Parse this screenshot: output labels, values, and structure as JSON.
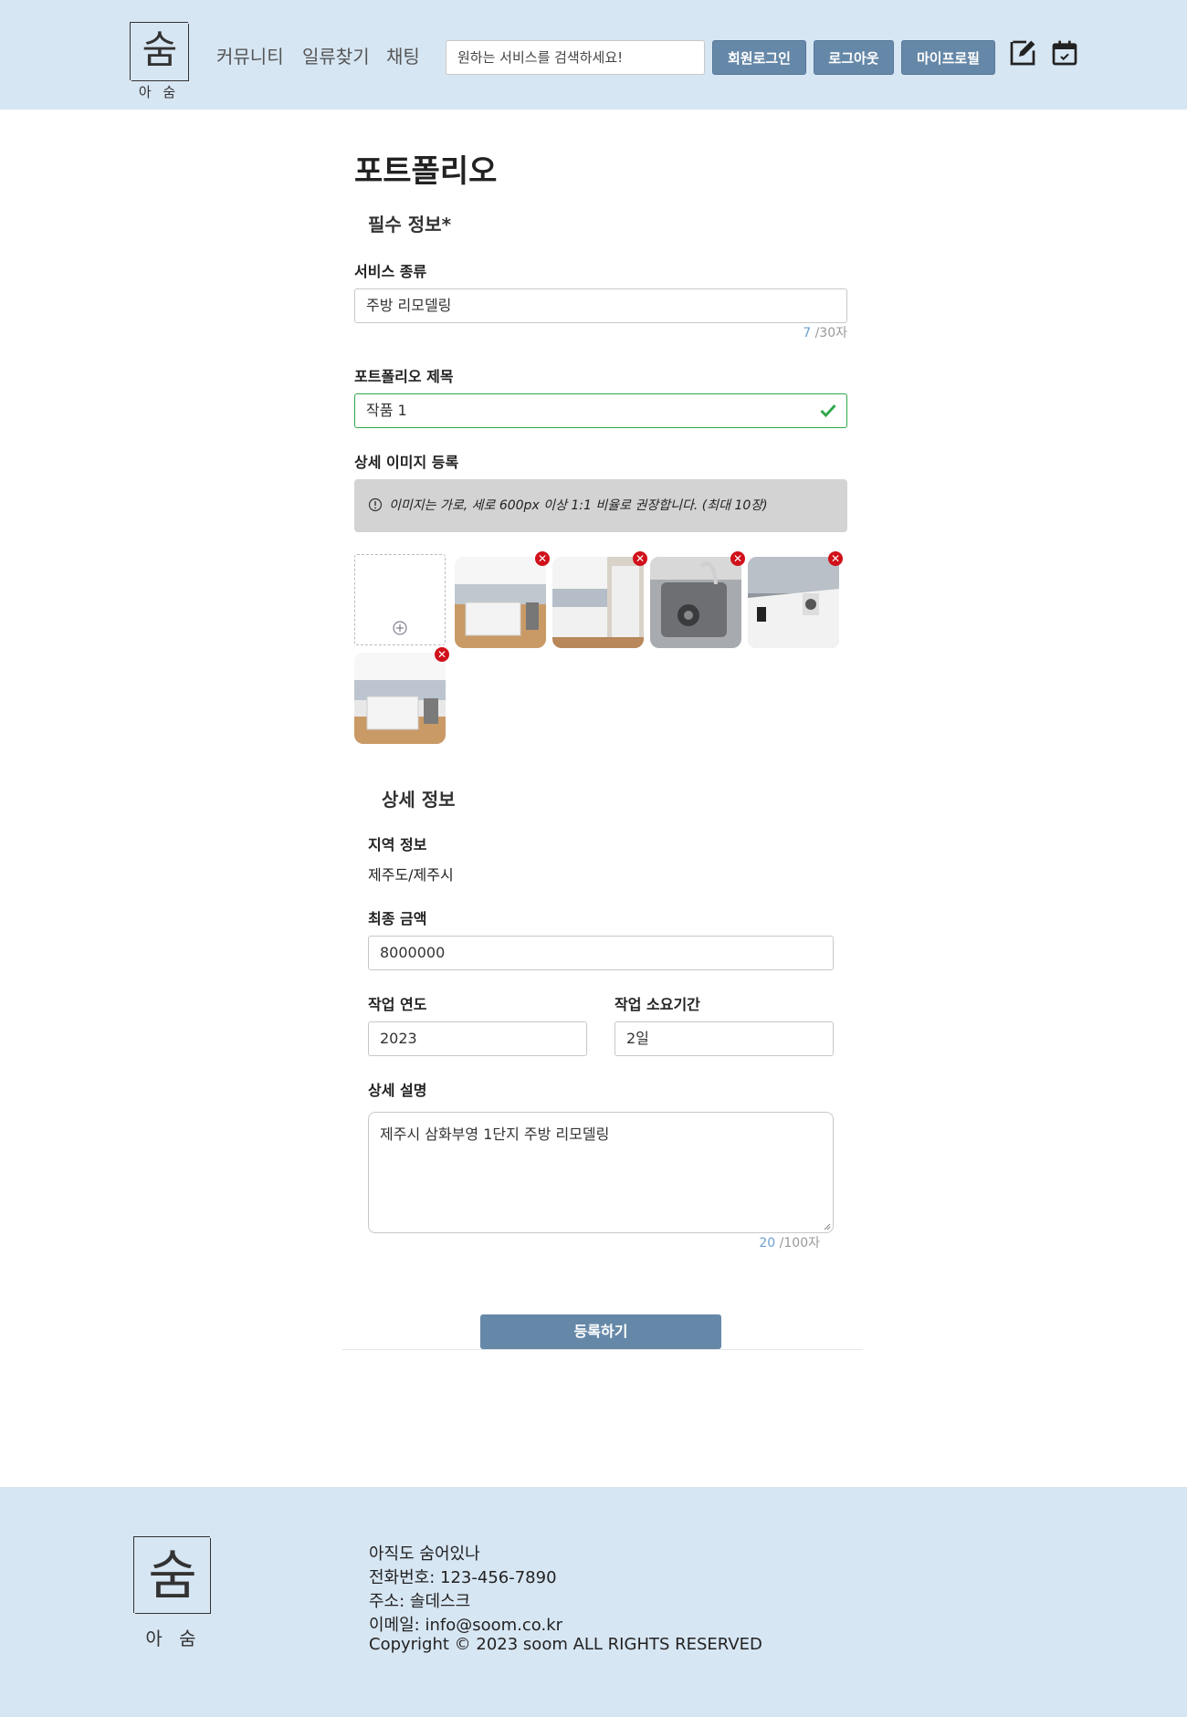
{
  "header": {
    "logo_char": "숨",
    "logo_sub": "아 숨",
    "nav": [
      "커뮤니티",
      "일류찾기",
      "채팅"
    ],
    "search_placeholder": "원하는 서비스를 검색하세요!",
    "buttons": {
      "login": "회원로그인",
      "logout": "로그아웃",
      "profile": "마이프로필"
    },
    "icons": [
      "edit-icon",
      "calendar-icon"
    ]
  },
  "page": {
    "title": "포트폴리오",
    "required_section": "필수 정보*",
    "service_type": {
      "label": "서비스 종류",
      "value": "주방 리모델링",
      "count": "7",
      "max": " /30자"
    },
    "portfolio_title": {
      "label": "포트폴리오 제목",
      "value": "작품 1"
    },
    "images": {
      "label": "상세 이미지 등록",
      "notice": "이미지는 가로, 세로 600px 이상 1:1 비율로 권장합니다. (최대 10장)",
      "count": 5
    },
    "detail_section": "상세 정보",
    "region": {
      "label": "지역 정보",
      "value": "제주도/제주시"
    },
    "final_price": {
      "label": "최종 금액",
      "value": "8000000"
    },
    "work_year": {
      "label": "작업 연도",
      "value": "2023"
    },
    "work_duration": {
      "label": "작업 소요기간",
      "value": "2일"
    },
    "description": {
      "label": "상세 설명",
      "value": "제주시 삼화부영 1단지 주방 리모델링",
      "count": "20",
      "max": " /100자"
    },
    "submit": "등록하기"
  },
  "footer": {
    "logo_char": "숨",
    "logo_sub": "아 숨",
    "lines": [
      "아직도 숨어있나",
      "전화번호: 123-456-7890",
      "주소: 솔데스크",
      "이메일: info@soom.co.kr",
      "Copyright © 2023 soom ALL RIGHTS RESERVED"
    ]
  },
  "colors": {
    "header_bg": "#d7e6f3",
    "button": "#6688a8",
    "valid": "#2fa84a",
    "delete": "#d0111b"
  }
}
